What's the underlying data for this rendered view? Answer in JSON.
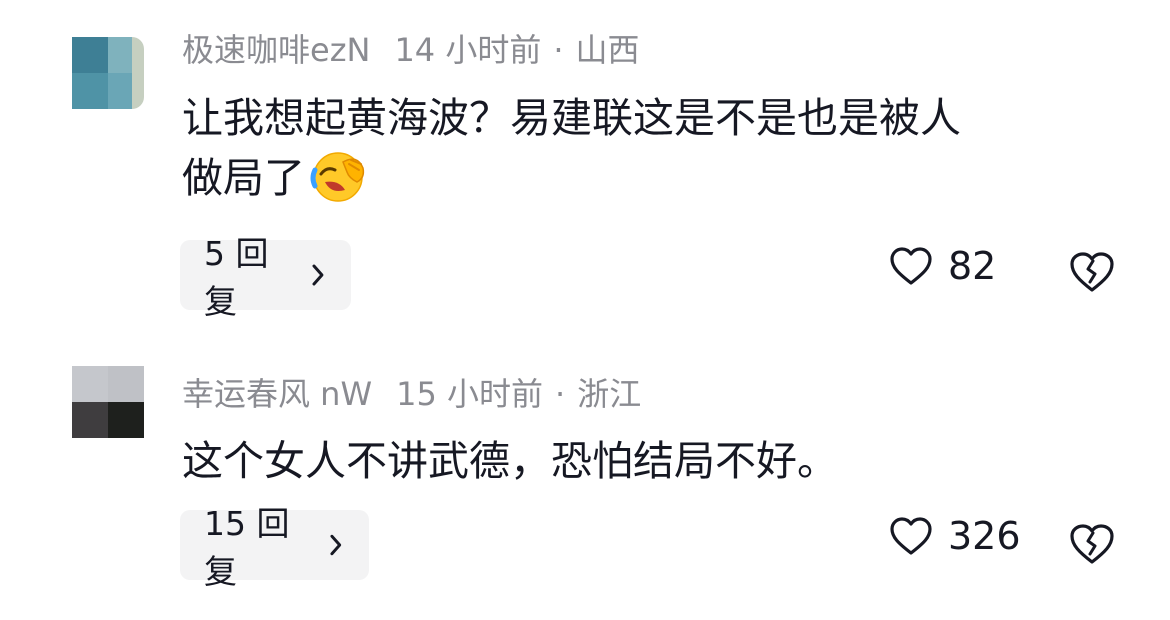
{
  "comments": [
    {
      "username": "极速咖啡ezN",
      "time": "14 小时前",
      "dot": "·",
      "location": "山西",
      "text_line1": "让我想起黄海波？易建联这是不是也是被人",
      "text_line2": "做局了",
      "emoji": "laughing-crying-emoji",
      "reply_label": "5 回复",
      "likes": "82",
      "avatar_colors": [
        "#3e7f95",
        "#6aa6b6",
        "#9fbfbf",
        "#4f93a6",
        "#5aa0b0",
        "#b7c7b2"
      ]
    },
    {
      "username": "幸运春风 nW",
      "time": "15 小时前",
      "dot": "·",
      "location": "浙江",
      "text_line1": "这个女人不讲武德，恐怕结局不好。",
      "reply_label": "15 回复",
      "likes": "326",
      "avatar_colors": [
        "#c5c7cc",
        "#c2c4c9",
        "#3f3d3f",
        "#1e201d"
      ]
    }
  ],
  "colors": {
    "meta_gray": "#8a8b91",
    "text_dark": "#161823",
    "reply_bg": "#f3f3f4"
  },
  "icons": {
    "like": "heart-outline-icon",
    "dislike": "broken-heart-outline-icon",
    "chevron": "chevron-right-icon"
  }
}
